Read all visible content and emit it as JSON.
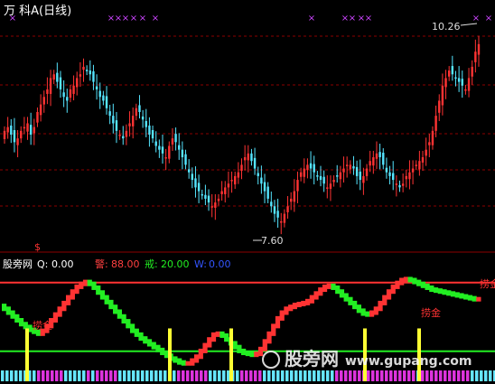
{
  "header": {
    "title": "万 科A(日线)"
  },
  "indicator": {
    "name": "股旁网",
    "q_label": "Q:",
    "q_value": "0.00",
    "warn_label": "警:",
    "warn_value": "88.00",
    "guard_label": "戒:",
    "guard_value": "20.00",
    "w_label": "W:",
    "w_value": "0.00",
    "signal_text": "捞金"
  },
  "watermark": {
    "text": "股旁网",
    "url": "www.gupang.com"
  },
  "colors": {
    "background": "#000000",
    "up": "#ff3333",
    "down": "#55e5ff",
    "marker": "#cc44ff",
    "grid": "#8b0000",
    "line_green": "#22ee22",
    "signal": "#ffff33",
    "warn_text": "#ff4040",
    "guard_text": "#22ee22",
    "w_text": "#3355ff"
  },
  "chart_data": [
    {
      "type": "candlestick",
      "max_label": "10.26",
      "min_label": "7.60",
      "ylim": [
        7.5,
        10.4
      ],
      "close": [
        9.0,
        9.05,
        8.95,
        8.85,
        8.9,
        9.0,
        9.05,
        9.1,
        8.95,
        9.05,
        9.25,
        9.35,
        9.45,
        9.55,
        9.7,
        9.75,
        9.65,
        9.55,
        9.45,
        9.4,
        9.55,
        9.6,
        9.7,
        9.75,
        9.85,
        9.8,
        9.75,
        9.65,
        9.55,
        9.45,
        9.4,
        9.3,
        9.2,
        9.1,
        9.0,
        8.95,
        8.9,
        9.0,
        9.1,
        9.2,
        9.3,
        9.25,
        9.15,
        9.05,
        8.95,
        8.9,
        8.8,
        8.75,
        8.7,
        8.65,
        8.8,
        8.9,
        8.85,
        8.75,
        8.65,
        8.55,
        8.45,
        8.35,
        8.25,
        8.2,
        8.15,
        8.1,
        8.05,
        8.0,
        8.05,
        8.1,
        8.2,
        8.25,
        8.3,
        8.35,
        8.4,
        8.45,
        8.55,
        8.65,
        8.7,
        8.6,
        8.5,
        8.4,
        8.3,
        8.2,
        8.1,
        8.0,
        7.9,
        7.85,
        7.8,
        7.9,
        8.0,
        8.1,
        8.2,
        8.35,
        8.45,
        8.5,
        8.55,
        8.5,
        8.45,
        8.4,
        8.35,
        8.3,
        8.25,
        8.3,
        8.35,
        8.4,
        8.45,
        8.5,
        8.55,
        8.55,
        8.5,
        8.4,
        8.35,
        8.4,
        8.5,
        8.6,
        8.65,
        8.7,
        8.65,
        8.55,
        8.45,
        8.4,
        8.35,
        8.3,
        8.25,
        8.3,
        8.4,
        8.45,
        8.5,
        8.55,
        8.6,
        8.65,
        8.75,
        8.85,
        9.0,
        9.2,
        9.4,
        9.6,
        9.7,
        9.8,
        9.75,
        9.7,
        9.65,
        9.6,
        9.55,
        9.7,
        9.85,
        10.05,
        10.15
      ],
      "markers": "sparse purple × symbols along the top edge",
      "grid": "dashed horizontal"
    },
    {
      "type": "line",
      "ylim": [
        0,
        100
      ],
      "levels": {
        "warn": 88,
        "guard": 20
      },
      "signal_bars": [
        30,
        188,
        256,
        404,
        464
      ],
      "value_curve": [
        65,
        62,
        58,
        54,
        50,
        46,
        43,
        40,
        38,
        36,
        39,
        44,
        50,
        56,
        62,
        68,
        74,
        80,
        85,
        88,
        90,
        88,
        84,
        79,
        74,
        69,
        64,
        59,
        54,
        49,
        44,
        39,
        35,
        31,
        28,
        25,
        22,
        19,
        16,
        13,
        10,
        8,
        6,
        5,
        5,
        8,
        12,
        18,
        24,
        30,
        35,
        36,
        34,
        30,
        26,
        22,
        18,
        16,
        15,
        14,
        15,
        20,
        28,
        36,
        44,
        52,
        58,
        62,
        64,
        66,
        67,
        68,
        70,
        74,
        78,
        82,
        85,
        86,
        84,
        80,
        76,
        72,
        68,
        64,
        60,
        57,
        56,
        58,
        62,
        68,
        74,
        80,
        85,
        89,
        92,
        93,
        92,
        90,
        88,
        86,
        84,
        82,
        81,
        80,
        79,
        78,
        77,
        76,
        75,
        74,
        73,
        72,
        72
      ]
    }
  ]
}
